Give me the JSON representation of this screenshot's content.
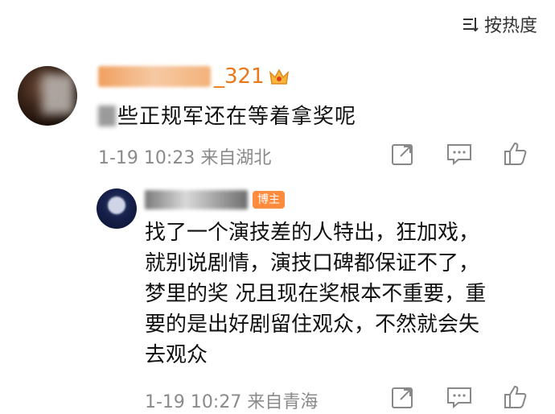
{
  "sort": {
    "label": "按热度"
  },
  "comment": {
    "username_visible": "_321",
    "text_visible": "些正规军还在等着拿奖呢",
    "time": "1-19 10:23",
    "location": "来自湖北"
  },
  "reply": {
    "badge": "博主",
    "lines": [
      "找了一个演技差的人特出，狂加戏，",
      "就别说剧情，演技口碑都保证不了，",
      "梦里的奖 况且现在奖根本不重要，重",
      "要的是出好剧留住观众，不然就会失",
      "去观众"
    ],
    "time": "1-19 10:27",
    "location": "来自青海"
  },
  "icons": {
    "share": "share-icon",
    "comment": "comment-icon",
    "like": "thumbs-up-icon",
    "sort": "sort-icon",
    "crown": "crown-icon"
  }
}
